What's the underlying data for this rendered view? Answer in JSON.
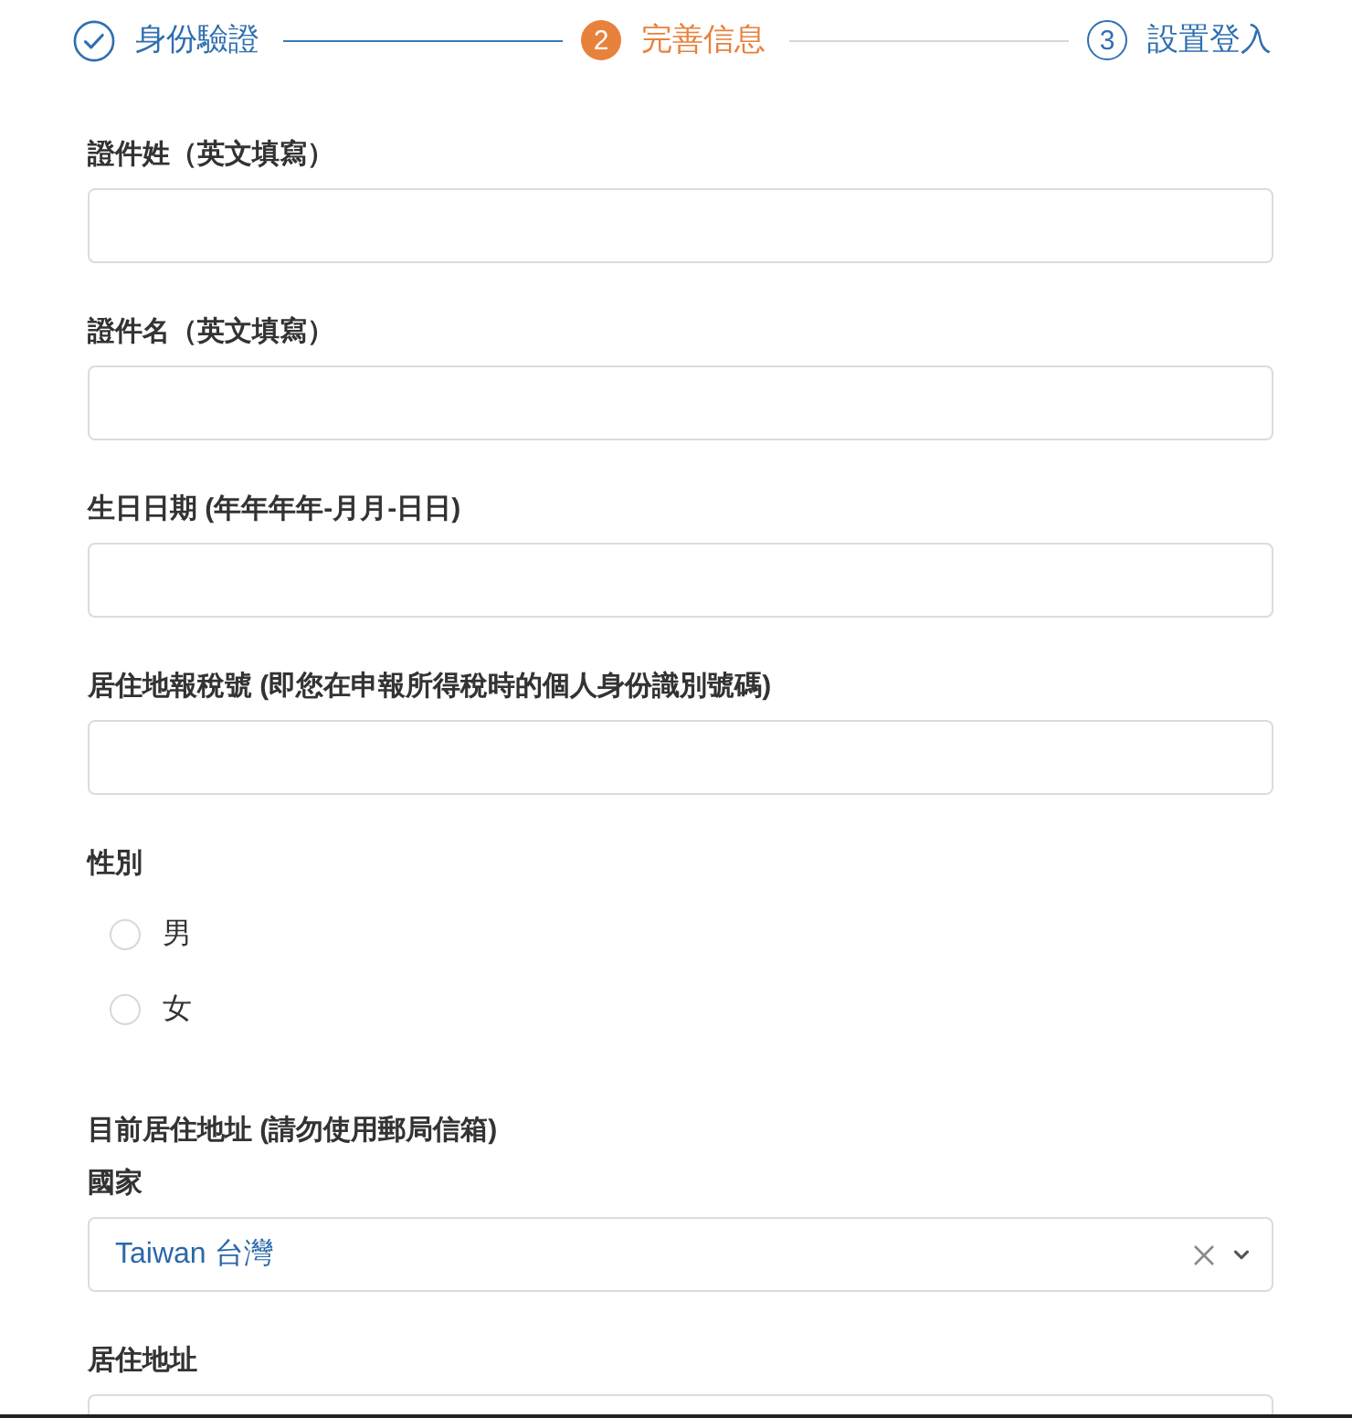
{
  "steps": [
    {
      "completed": true,
      "selected": false,
      "label": "身份驗證"
    },
    {
      "completed": false,
      "selected": true,
      "number": "2",
      "label": "完善信息"
    },
    {
      "completed": false,
      "selected": false,
      "number": "3",
      "label": "設置登入"
    }
  ],
  "fields": [
    {
      "kind": "text",
      "label": "證件姓（英文填寫）"
    },
    {
      "kind": "text",
      "label": "證件名（英文填寫）"
    },
    {
      "kind": "text",
      "label": "生日日期 (年年年年-月月-日日)"
    },
    {
      "kind": "text",
      "label": "居住地報稅號 (即您在申報所得稅時的個人身份識別號碼)"
    },
    {
      "kind": "radio",
      "label": "性別",
      "options": [
        {
          "label": "男",
          "selected": false
        },
        {
          "label": "女",
          "selected": false
        }
      ]
    },
    {
      "kind": "heading",
      "label": "目前居住地址 (請勿使用郵局信箱)"
    },
    {
      "kind": "select",
      "label": "國家",
      "value": "Taiwan 台灣"
    },
    {
      "kind": "text",
      "label": "居住地址"
    }
  ]
}
